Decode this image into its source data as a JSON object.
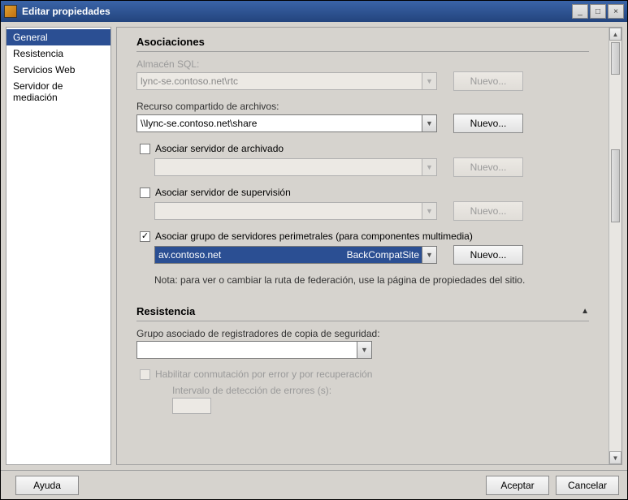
{
  "window": {
    "title": "Editar propiedades",
    "minimize": "_",
    "maximize": "□",
    "close": "×"
  },
  "sidebar": {
    "items": [
      {
        "label": "General",
        "selected": true
      },
      {
        "label": "Resistencia",
        "selected": false
      },
      {
        "label": "Servicios Web",
        "selected": false
      },
      {
        "label": "Servidor de mediación",
        "selected": false
      }
    ]
  },
  "buttons": {
    "new": "Nuevo...",
    "help": "Ayuda",
    "accept": "Aceptar",
    "cancel": "Cancelar"
  },
  "sections": {
    "associations": {
      "title": "Asociaciones",
      "sql": {
        "label": "Almacén SQL:",
        "value": "lync-se.contoso.net\\rtc"
      },
      "fileshare": {
        "label": "Recurso compartido de archivos:",
        "value": "\\\\lync-se.contoso.net\\share"
      },
      "archive": {
        "checkbox_label": "Asociar servidor de archivado",
        "checked": false,
        "value": ""
      },
      "monitor": {
        "checkbox_label": "Asociar servidor de supervisión",
        "checked": false,
        "value": ""
      },
      "edge": {
        "checkbox_label": "Asociar grupo de servidores perimetrales (para componentes multimedia)",
        "checked": true,
        "value": "av.contoso.net",
        "right": "BackCompatSite"
      },
      "note": "Nota: para ver o cambiar la ruta de federación, use la página de propiedades del sitio."
    },
    "resistance": {
      "title": "Resistencia",
      "registrar_label": "Grupo asociado de registradores de copia de seguridad:",
      "registrar_value": "",
      "failover_label": "Habilitar conmutación por error y por recuperación",
      "interval_label": "Intervalo de detección de errores (s):",
      "interval_value": ""
    }
  }
}
